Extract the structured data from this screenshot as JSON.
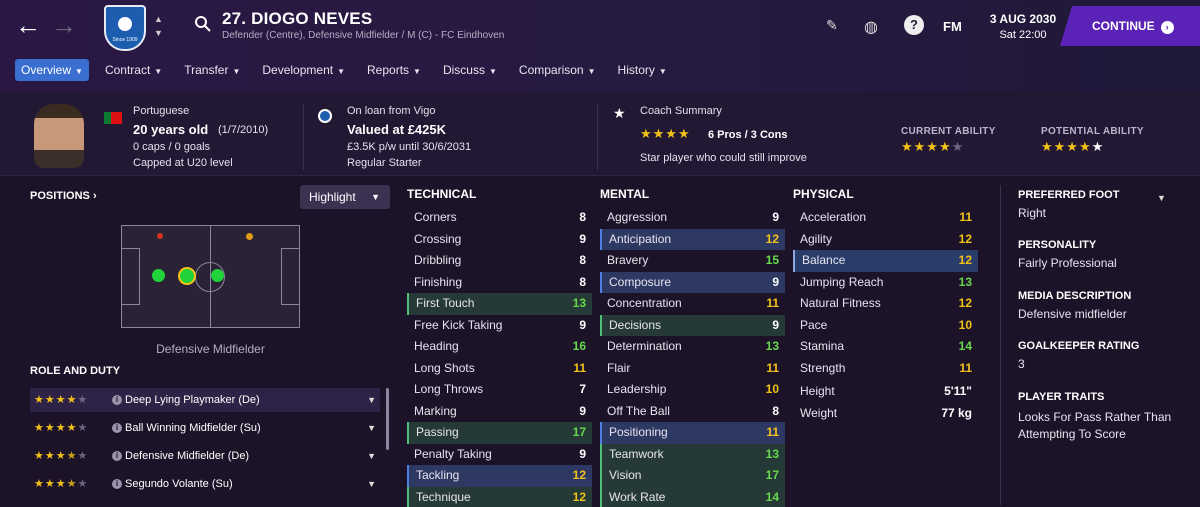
{
  "header": {
    "player_title": "27. DIOGO NEVES",
    "subtitle": "Defender (Centre), Defensive Midfielder / M (C) - FC Eindhoven",
    "crest_text": "Since 1909",
    "fm_label": "FM",
    "date": "3 AUG 2030",
    "time": "Sat 22:00",
    "continue_label": "CONTINUE"
  },
  "tabs": [
    "Overview",
    "Contract",
    "Transfer",
    "Development",
    "Reports",
    "Discuss",
    "Comparison",
    "History"
  ],
  "info": {
    "nationality": "Portuguese",
    "age": "20 years old",
    "dob": "(1/7/2010)",
    "caps": "0 caps / 0 goals",
    "capped_level": "Capped at U20 level",
    "loan": "On loan from Vigo",
    "value": "Valued at £425K",
    "wage": "£3.5K p/w until 30/6/2031",
    "status": "Regular Starter",
    "coach_title": "Coach Summary",
    "coach_stars": 4,
    "pros_cons": "6 Pros / 3 Cons",
    "coach_note": "Star player who could still improve",
    "current_ability_label": "CURRENT ABILITY",
    "current_ability_stars": 4,
    "potential_ability_label": "POTENTIAL ABILITY",
    "potential_ability_stars": 5
  },
  "positions": {
    "label": "POSITIONS",
    "highlight": "Highlight",
    "role_label": "Defensive Midfielder"
  },
  "roles": {
    "label": "ROLE AND DUTY",
    "items": [
      {
        "name": "Deep Lying Playmaker (De)",
        "stars": 4
      },
      {
        "name": "Ball Winning Midfielder (Su)",
        "stars": 4
      },
      {
        "name": "Defensive Midfielder (De)",
        "stars": 3.5
      },
      {
        "name": "Segundo Volante (Su)",
        "stars": 3.5
      }
    ]
  },
  "technical": {
    "label": "TECHNICAL",
    "attrs": [
      {
        "name": "Corners",
        "value": 8,
        "hl": ""
      },
      {
        "name": "Crossing",
        "value": 9,
        "hl": ""
      },
      {
        "name": "Dribbling",
        "value": 8,
        "hl": ""
      },
      {
        "name": "Finishing",
        "value": 8,
        "hl": ""
      },
      {
        "name": "First Touch",
        "value": 13,
        "hl": "gr"
      },
      {
        "name": "Free Kick Taking",
        "value": 9,
        "hl": ""
      },
      {
        "name": "Heading",
        "value": 16,
        "hl": ""
      },
      {
        "name": "Long Shots",
        "value": 11,
        "hl": ""
      },
      {
        "name": "Long Throws",
        "value": 7,
        "hl": ""
      },
      {
        "name": "Marking",
        "value": 9,
        "hl": ""
      },
      {
        "name": "Passing",
        "value": 17,
        "hl": "gr"
      },
      {
        "name": "Penalty Taking",
        "value": 9,
        "hl": ""
      },
      {
        "name": "Tackling",
        "value": 12,
        "hl": "bl"
      },
      {
        "name": "Technique",
        "value": 12,
        "hl": "gr"
      }
    ]
  },
  "mental": {
    "label": "MENTAL",
    "attrs": [
      {
        "name": "Aggression",
        "value": 9,
        "hl": ""
      },
      {
        "name": "Anticipation",
        "value": 12,
        "hl": "bl"
      },
      {
        "name": "Bravery",
        "value": 15,
        "hl": ""
      },
      {
        "name": "Composure",
        "value": 9,
        "hl": "bl"
      },
      {
        "name": "Concentration",
        "value": 11,
        "hl": ""
      },
      {
        "name": "Decisions",
        "value": 9,
        "hl": "gr"
      },
      {
        "name": "Determination",
        "value": 13,
        "hl": ""
      },
      {
        "name": "Flair",
        "value": 11,
        "hl": ""
      },
      {
        "name": "Leadership",
        "value": 10,
        "hl": ""
      },
      {
        "name": "Off The Ball",
        "value": 8,
        "hl": ""
      },
      {
        "name": "Positioning",
        "value": 11,
        "hl": "bl"
      },
      {
        "name": "Teamwork",
        "value": 13,
        "hl": "gr"
      },
      {
        "name": "Vision",
        "value": 17,
        "hl": "gr"
      },
      {
        "name": "Work Rate",
        "value": 14,
        "hl": "gr"
      }
    ]
  },
  "physical": {
    "label": "PHYSICAL",
    "attrs": [
      {
        "name": "Acceleration",
        "value": 11,
        "hl": ""
      },
      {
        "name": "Agility",
        "value": 12,
        "hl": ""
      },
      {
        "name": "Balance",
        "value": 12,
        "hl": "wh"
      },
      {
        "name": "Jumping Reach",
        "value": 13,
        "hl": ""
      },
      {
        "name": "Natural Fitness",
        "value": 12,
        "hl": ""
      },
      {
        "name": "Pace",
        "value": 10,
        "hl": ""
      },
      {
        "name": "Stamina",
        "value": 14,
        "hl": ""
      },
      {
        "name": "Strength",
        "value": 11,
        "hl": ""
      }
    ],
    "height_label": "Height",
    "height": "5'11\"",
    "weight_label": "Weight",
    "weight": "77 kg"
  },
  "side": {
    "foot_label": "PREFERRED FOOT",
    "foot": "Right",
    "personality_label": "PERSONALITY",
    "personality": "Fairly Professional",
    "media_label": "MEDIA DESCRIPTION",
    "media": "Defensive midfielder",
    "gk_label": "GOALKEEPER RATING",
    "gk": "3",
    "traits_label": "PLAYER TRAITS",
    "traits": "Looks For Pass Rather Than Attempting To Score"
  },
  "colors": {
    "accent": "#5b22b7",
    "tab_active": "#3a6fd1",
    "star": "#f3c218",
    "good": "#68d84c"
  }
}
